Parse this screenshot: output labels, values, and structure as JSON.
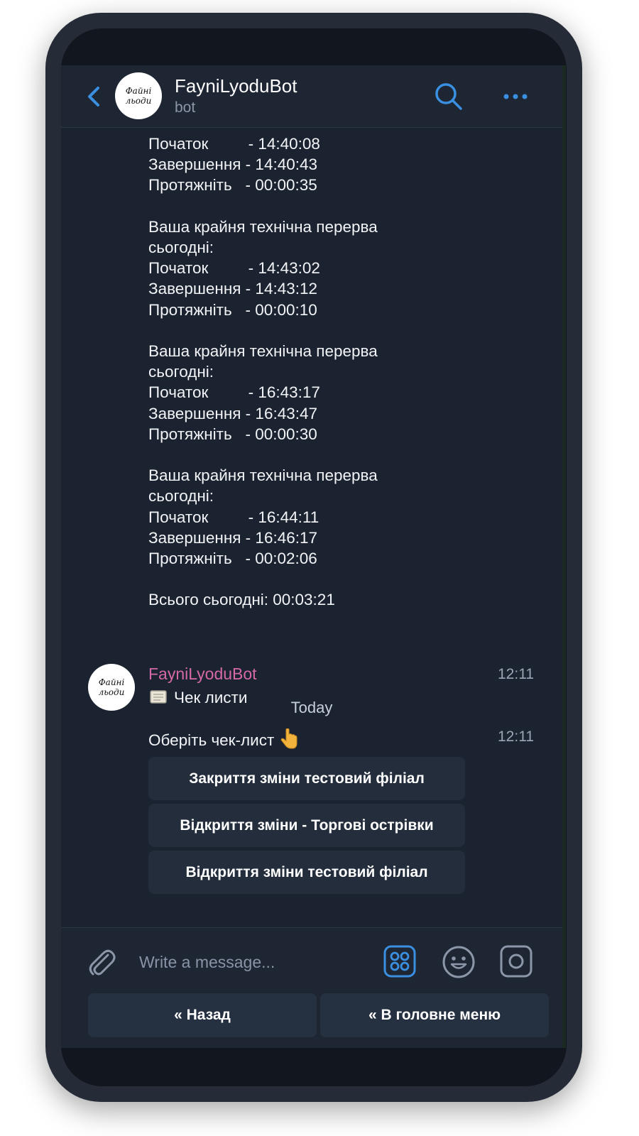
{
  "header": {
    "title": "FayniLyoduBot",
    "status": "bot",
    "avatar_text": "Файні льоди",
    "icons": [
      "back-arrow-icon",
      "search-icon",
      "more-icon"
    ]
  },
  "chat": {
    "previous_message": "Початок         - 14:40:08\nЗавершення - 14:40:43\nПротяжніть   - 00:00:35\n\nВаша крайня технічна перерва\nсьогодні:\nПочаток         - 14:43:02\nЗавершення - 14:43:12\nПротяжніть   - 00:00:10\n\nВаша крайня технічна перерва\nсьогодні:\nПочаток         - 16:43:17\nЗавершення - 16:43:47\nПротяжніть   - 00:00:30\n\nВаша крайня технічна перерва\nсьогодні:\nПочаток         - 16:44:11\nЗавершення - 16:46:17\nПротяжніть   - 00:02:06\n\nВсього сьогодні: 00:03:21",
    "day_separator": "Today",
    "sender": "FayniLyoduBot",
    "messages": [
      {
        "text": "Чек листи",
        "time": "12:11",
        "emoji": "scroll-icon"
      },
      {
        "text": "Оберіть чек-лист",
        "time": "12:11",
        "emoji": "pointing-down-icon"
      }
    ],
    "inline_buttons": [
      "Закриття зміни тестовий філіал",
      "Відкриття зміни - Торгові острівки",
      "Відкриття зміни тестовий філіал"
    ]
  },
  "composer": {
    "placeholder": "Write a message...",
    "icons": [
      "paperclip-icon",
      "bot-commands-icon",
      "emoji-icon",
      "camera-icon"
    ],
    "accent": "#3a8fe0"
  },
  "keyboard": {
    "buttons": [
      "« Назад",
      "« В головне меню"
    ]
  }
}
